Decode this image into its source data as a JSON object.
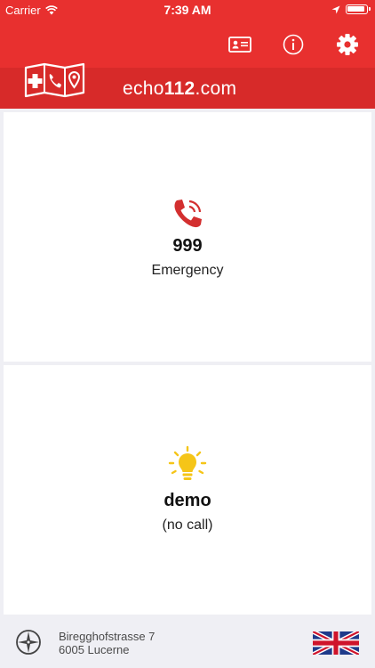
{
  "status_bar": {
    "carrier": "Carrier",
    "time": "7:39 AM"
  },
  "header": {
    "brand_prefix": "echo",
    "brand_number": "112",
    "brand_suffix": ".com",
    "buttons": [
      "id-card-icon",
      "info-icon",
      "gear-icon"
    ]
  },
  "emergency": {
    "number": "999",
    "label": "Emergency",
    "icon": "phone-icon",
    "icon_color": "#d32f2f"
  },
  "demo": {
    "title": "demo",
    "label": "(no call)",
    "icon": "lightbulb-icon",
    "icon_color": "#f5c518"
  },
  "location": {
    "street": "Biregghofstrasse 7",
    "city": "6005 Lucerne",
    "flag": "uk-flag-icon"
  },
  "colors": {
    "header_red": "#e8302f",
    "brand_bar_red": "#d72a29",
    "background": "#efeff4"
  }
}
